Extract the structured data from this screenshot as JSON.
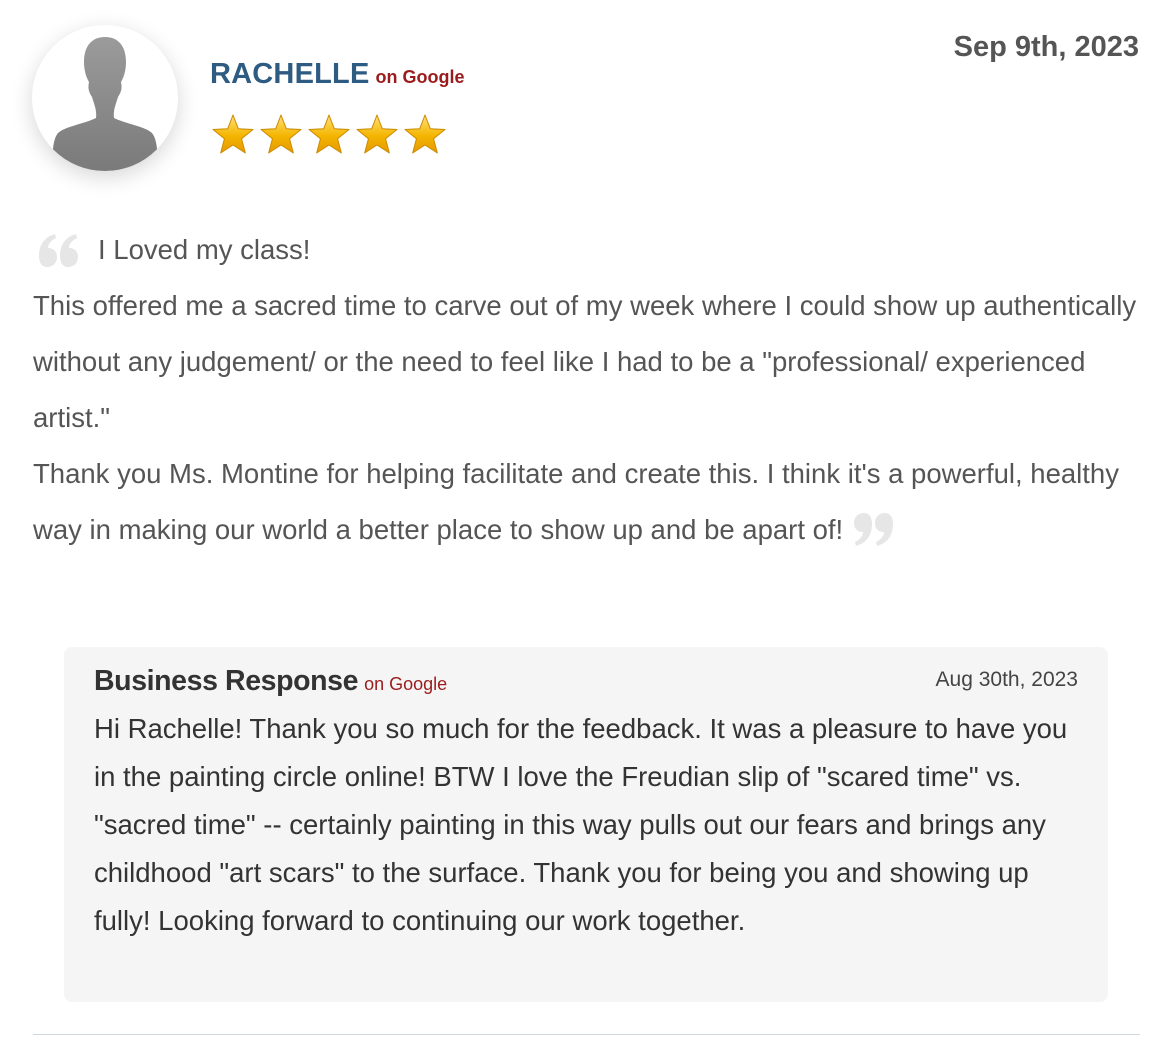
{
  "reviewer": {
    "name": "RACHELLE",
    "source": "on Google",
    "rating": 5,
    "rating_max": 5,
    "avatar_icon": "person-silhouette-icon"
  },
  "review": {
    "date": "Sep 9th, 2023",
    "paragraphs": [
      "I Loved my class!",
      "This offered me a sacred time to carve out of my week where I could show up authentically without any judgement/ or the need to feel like I had to be a \"professional/ experienced artist.\"",
      "Thank you Ms. Montine for helping facilitate and create this. I think it's a powerful, healthy way in making our world a better place to show up and be apart of!"
    ]
  },
  "response": {
    "title": "Business Response",
    "source": "on Google",
    "date": "Aug 30th, 2023",
    "text": "Hi Rachelle! Thank you so much for the feedback. It was a pleasure to have you in the painting circle online! BTW I love the Freudian slip of \"scared time\" vs. \"sacred time\" -- certainly painting in this way pulls out our fears and brings any childhood \"art scars\" to the surface. Thank you for being you and showing up fully! Looking forward to continuing our work together."
  },
  "colors": {
    "name": "#2e5b82",
    "source": "#9a1c1c",
    "body_text": "#555555",
    "star": "#f5b400",
    "response_bg": "#f5f5f5"
  }
}
